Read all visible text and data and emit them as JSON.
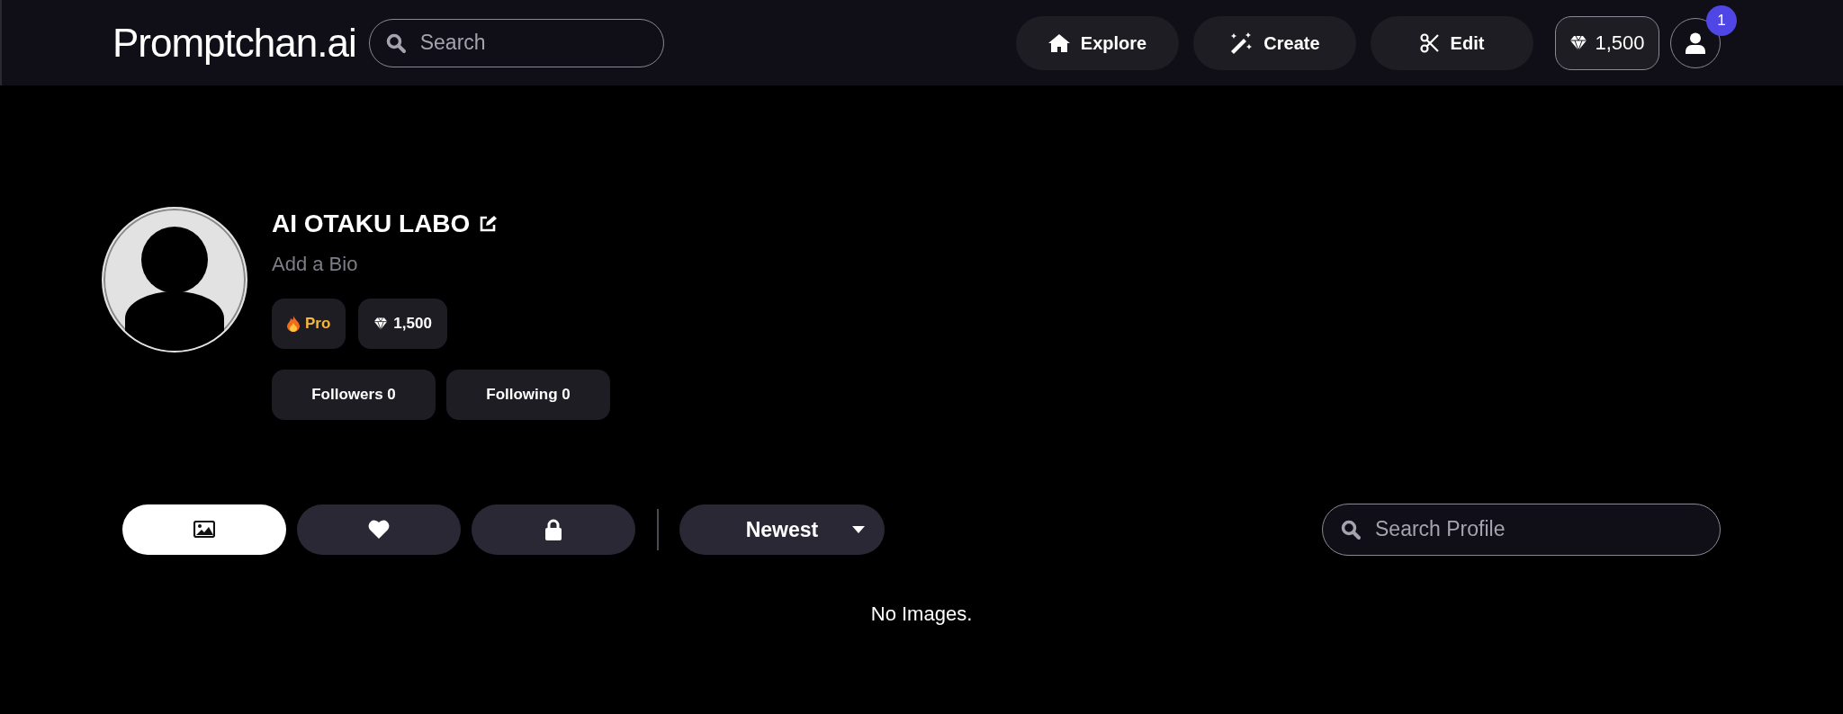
{
  "header": {
    "logo": {
      "main": "Promptchan",
      "suffix": ".ai"
    },
    "search": {
      "placeholder": "Search"
    },
    "nav": [
      {
        "label": "Explore",
        "kind": "home"
      },
      {
        "label": "Create",
        "kind": "create"
      },
      {
        "label": "Edit",
        "kind": "edit"
      }
    ],
    "gems": "1,500",
    "notification_count": "1"
  },
  "profile": {
    "name": "AI OTAKU LABO",
    "bio_placeholder": "Add a Bio",
    "badges": [
      {
        "kind": "plan",
        "label": "Pro"
      },
      {
        "kind": "gems",
        "label": "1,500"
      }
    ],
    "stats": [
      "Followers 0",
      "Following 0"
    ]
  },
  "tabs": [
    {
      "kind": "images",
      "selected": true
    },
    {
      "kind": "liked",
      "selected": false
    },
    {
      "kind": "private",
      "selected": false
    }
  ],
  "sort": {
    "label": "Newest"
  },
  "profile_search": {
    "placeholder": "Search Profile"
  },
  "empty_message": "No Images."
}
